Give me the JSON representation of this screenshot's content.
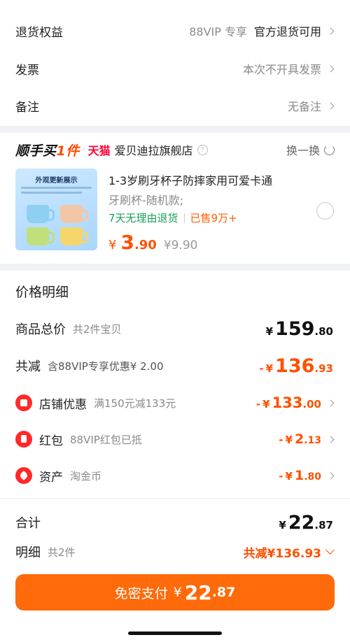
{
  "options": {
    "return": {
      "label": "退货权益",
      "tag": "88VIP 专享",
      "value": "官方退货可用"
    },
    "invoice": {
      "label": "发票",
      "value": "本次不开具发票"
    },
    "note": {
      "label": "备注",
      "value": "无备注"
    }
  },
  "shop": {
    "brand_a": "顺手买",
    "brand_b": "1件",
    "dot": "·",
    "platform": "天猫",
    "name": "爱贝迪拉旗舰店",
    "help": "?",
    "swap_label": "换一换"
  },
  "product": {
    "thumb_title": "外观更新展示",
    "title": "1-3岁刷牙杯子防摔家用可爱卡通",
    "sku": "牙刷杯-随机款;",
    "return_tag": "7天无理由退货",
    "sold": "已售9万+",
    "currency": "¥",
    "price_int": "3",
    "price_dec": ".90",
    "original_price": "¥9.90"
  },
  "price_details": {
    "title": "价格明细",
    "total": {
      "label": "商品总价",
      "sub": "共2件宝贝",
      "currency": "¥",
      "int": "159",
      "dec": ".80"
    },
    "discount": {
      "label": "共减",
      "sub": "含88VIP专享优惠¥ 2.00",
      "prefix": "-",
      "currency": "¥",
      "int": "136",
      "dec": ".93"
    },
    "store": {
      "label": "店铺优惠",
      "sub": "满150元减133元",
      "prefix": "-",
      "currency": "¥",
      "int": "133",
      "dec": ".00"
    },
    "redpacket": {
      "label": "红包",
      "sub": "88VIP红包已抵",
      "prefix": "-",
      "currency": "¥",
      "int": "2",
      "dec": ".13"
    },
    "asset": {
      "label": "资产",
      "sub": "淘金币",
      "prefix": "-",
      "currency": "¥",
      "int": "1",
      "dec": ".80"
    },
    "sum": {
      "label": "合计",
      "currency": "¥",
      "int": "22",
      "dec": ".87"
    },
    "detail": {
      "label": "明细",
      "sub": "共2件",
      "value": "共减¥136.93"
    }
  },
  "pay": {
    "label": "免密支付",
    "currency": "¥",
    "int": "22",
    "dec": ".87"
  },
  "colors": {
    "accent": "#ff5000",
    "button": "#ff6a0a",
    "green": "#1aa05a",
    "tmall": "#ff0036"
  }
}
